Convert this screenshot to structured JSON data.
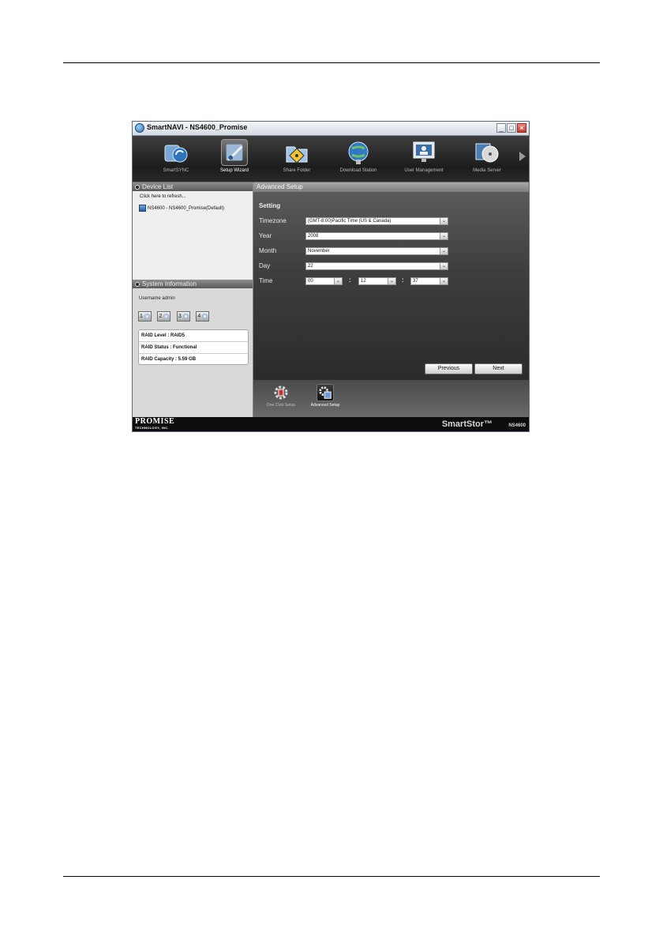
{
  "window": {
    "title": "SmartNAVI - NS4600_Promise",
    "minimize": "_",
    "maximize": "□",
    "close": "×"
  },
  "toolbar": {
    "items": [
      {
        "label": "SmartSYNC",
        "icon": "sync-icon"
      },
      {
        "label": "Setup Wizard",
        "icon": "wizard-icon",
        "active": true
      },
      {
        "label": "Share Folder",
        "icon": "share-folder-icon"
      },
      {
        "label": "Download Station",
        "icon": "globe-download-icon"
      },
      {
        "label": "User Management",
        "icon": "user-monitor-icon"
      },
      {
        "label": "Media Server",
        "icon": "media-disc-icon"
      }
    ]
  },
  "device_list": {
    "header": "Device List",
    "refresh": "Click here to refresh...",
    "device": "NS4600 - NS4600_Promise(Default)"
  },
  "system_info": {
    "header": "System Information",
    "username": "Username admin",
    "disks": [
      "1",
      "2",
      "3",
      "4"
    ],
    "raid_level": "RAID Level : RAID5",
    "raid_status": "RAID Status : Functional",
    "raid_capacity": "RAID Capacity : 5.59 GB"
  },
  "main": {
    "header": "Advanced Setup",
    "section": "Setting",
    "labels": {
      "timezone": "Timezone",
      "year": "Year",
      "month": "Month",
      "day": "Day",
      "time": "Time"
    },
    "timezone": "(GMT-8:00)Pacific Time (US & Canada)",
    "year": "2008",
    "month": "November",
    "day": "22",
    "hour": "00",
    "minute": "12",
    "second": "37",
    "sep": ":",
    "previous": "Previous",
    "next": "Next",
    "dropdown_glyph": "⌄"
  },
  "bottom_tabs": [
    {
      "label": "One Click Setup",
      "icon": "one-click-gear-icon"
    },
    {
      "label": "Advanced Setup",
      "icon": "advanced-gear-icon",
      "active": true
    }
  ],
  "footer": {
    "brand": "PROMISE",
    "brand_sub": "TECHNOLOGY, INC.",
    "product": "SmartStor™",
    "model": "NS4600"
  }
}
